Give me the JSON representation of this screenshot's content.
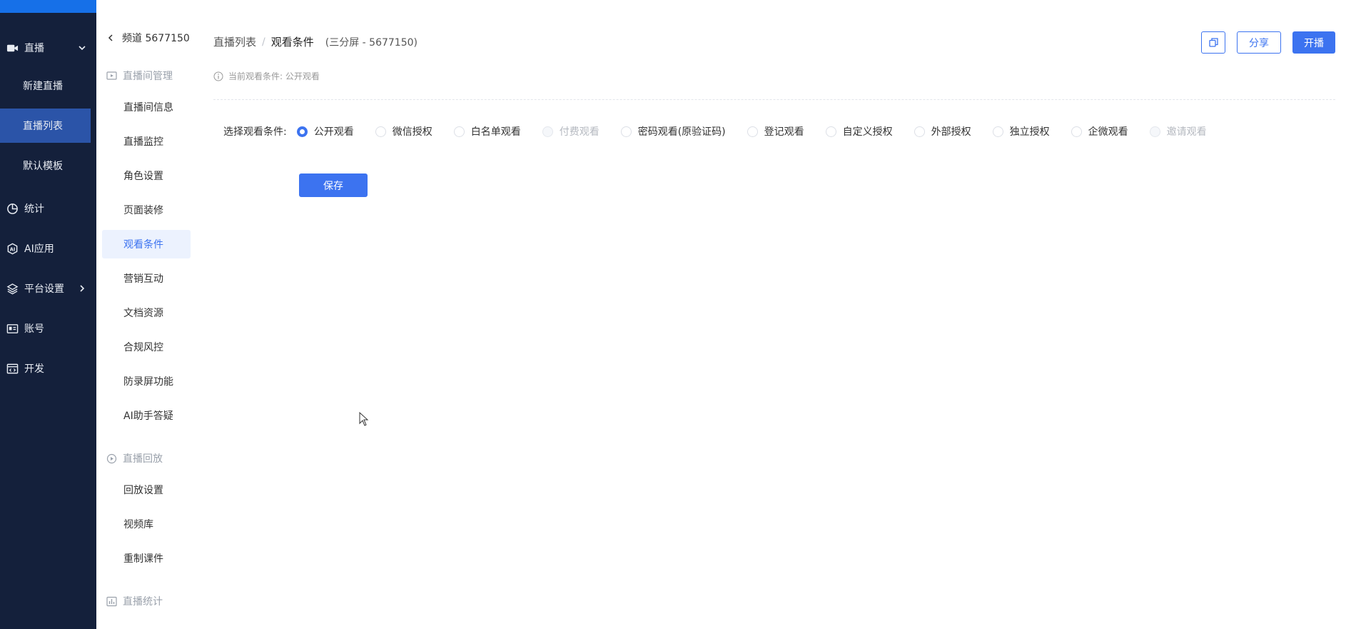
{
  "leftnav": {
    "live": {
      "label": "直播",
      "icon": "video-camera-icon"
    },
    "live_sub": [
      {
        "label": "新建直播",
        "active": false
      },
      {
        "label": "直播列表",
        "active": true
      },
      {
        "label": "默认模板",
        "active": false
      }
    ],
    "stats": {
      "label": "统计",
      "icon": "pie-chart-icon"
    },
    "ai": {
      "label": "AI应用",
      "icon": "ai-hexagon-icon"
    },
    "platform": {
      "label": "平台设置",
      "icon": "layers-icon"
    },
    "account": {
      "label": "账号",
      "icon": "id-card-icon"
    },
    "dev": {
      "label": "开发",
      "icon": "code-window-icon"
    }
  },
  "subnav": {
    "back_label": "频道 5677150",
    "groups": [
      {
        "title": "直播间管理",
        "icon": "monitor-play-icon"
      },
      {
        "title": "直播回放",
        "icon": "replay-circle-icon"
      },
      {
        "title": "直播统计",
        "icon": "bar-chart-icon"
      }
    ],
    "items": [
      "直播间信息",
      "直播监控",
      "角色设置",
      "页面装修",
      "观看条件",
      "营销互动",
      "文档资源",
      "合规风控",
      "防录屏功能",
      "AI助手答疑",
      "回放设置",
      "视频库",
      "重制课件"
    ],
    "active_item": "观看条件"
  },
  "header": {
    "crumb_parent": "直播列表",
    "crumb_current": "观看条件",
    "note": "(三分屏 - 5677150)",
    "share_label": "分享",
    "live_label": "开播",
    "copy_icon": "copy-icon"
  },
  "info": {
    "text": "当前观看条件: 公开观看",
    "icon": "info-circle-icon"
  },
  "condition": {
    "label": "选择观看条件:",
    "options": [
      {
        "label": "公开观看",
        "checked": true,
        "disabled": false
      },
      {
        "label": "微信授权",
        "checked": false,
        "disabled": false
      },
      {
        "label": "白名单观看",
        "checked": false,
        "disabled": false
      },
      {
        "label": "付费观看",
        "checked": false,
        "disabled": true
      },
      {
        "label": "密码观看(原验证码)",
        "checked": false,
        "disabled": false
      },
      {
        "label": "登记观看",
        "checked": false,
        "disabled": false
      },
      {
        "label": "自定义授权",
        "checked": false,
        "disabled": false
      },
      {
        "label": "外部授权",
        "checked": false,
        "disabled": false
      },
      {
        "label": "独立授权",
        "checked": false,
        "disabled": false
      },
      {
        "label": "企微观看",
        "checked": false,
        "disabled": false
      },
      {
        "label": "邀请观看",
        "checked": false,
        "disabled": true
      }
    ],
    "save_label": "保存"
  },
  "colors": {
    "nav_bg": "#14203b",
    "nav_active": "#2b54a8",
    "accent": "#3c73f0",
    "top_strip": "#1670e8"
  }
}
